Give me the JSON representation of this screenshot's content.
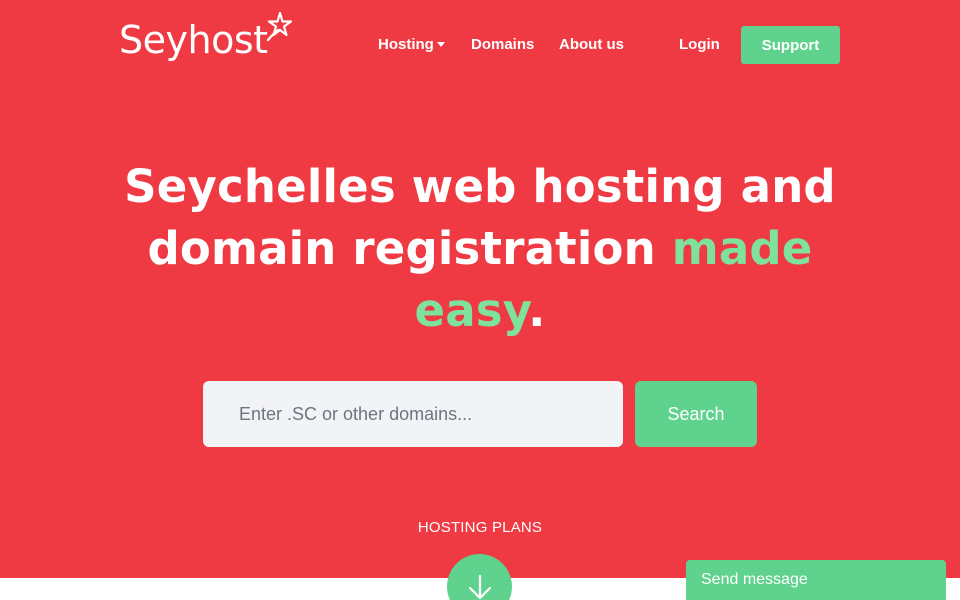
{
  "brand": {
    "name": "Seyhost"
  },
  "nav": {
    "items": [
      {
        "label": "Hosting",
        "has_dropdown": true
      },
      {
        "label": "Domains"
      },
      {
        "label": "About us"
      }
    ],
    "login_label": "Login",
    "support_label": "Support"
  },
  "hero": {
    "headline_line1": "Seychelles web hosting and",
    "headline_line2": "domain registration",
    "headline_accent_1": "made",
    "headline_accent_2": "easy",
    "headline_end": "."
  },
  "search": {
    "placeholder": "Enter .SC or other domains...",
    "value": "",
    "button_label": "Search"
  },
  "plans": {
    "label": "HOSTING PLANS",
    "scroll_icon": "arrow-down-icon"
  },
  "chat": {
    "label": "Send message"
  },
  "colors": {
    "hero_bg": "#ef3a44",
    "accent_green": "#5fd38d",
    "headline_accent": "#7ee29d",
    "input_bg": "#f2f3f6"
  }
}
